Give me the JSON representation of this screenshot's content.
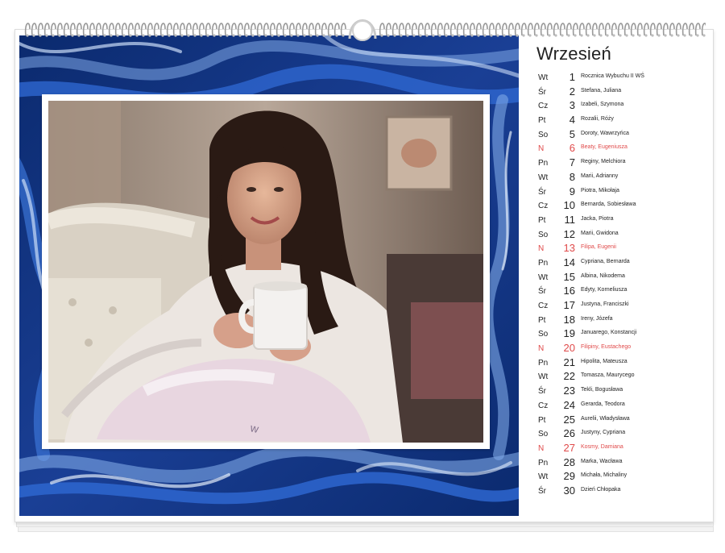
{
  "calendar": {
    "month": "Wrzesień",
    "days": [
      {
        "dow": "Wt",
        "num": "1",
        "names": "Rocznica Wybuchu II WŚ",
        "sunday": false
      },
      {
        "dow": "Śr",
        "num": "2",
        "names": "Stefana, Juliana",
        "sunday": false
      },
      {
        "dow": "Cz",
        "num": "3",
        "names": "Izabeli, Szymona",
        "sunday": false
      },
      {
        "dow": "Pt",
        "num": "4",
        "names": "Rozalii, Róży",
        "sunday": false
      },
      {
        "dow": "So",
        "num": "5",
        "names": "Doroty, Wawrzyńca",
        "sunday": false
      },
      {
        "dow": "N",
        "num": "6",
        "names": "Beaty, Eugeniusza",
        "sunday": true
      },
      {
        "dow": "Pn",
        "num": "7",
        "names": "Reginy, Melchiora",
        "sunday": false
      },
      {
        "dow": "Wt",
        "num": "8",
        "names": "Marii, Adrianny",
        "sunday": false
      },
      {
        "dow": "Śr",
        "num": "9",
        "names": "Piotra, Mikołaja",
        "sunday": false
      },
      {
        "dow": "Cz",
        "num": "10",
        "names": "Bernarda, Sobiesława",
        "sunday": false
      },
      {
        "dow": "Pt",
        "num": "11",
        "names": "Jacka, Piotra",
        "sunday": false
      },
      {
        "dow": "So",
        "num": "12",
        "names": "Marii, Gwidona",
        "sunday": false
      },
      {
        "dow": "N",
        "num": "13",
        "names": "Filipa, Eugenii",
        "sunday": true
      },
      {
        "dow": "Pn",
        "num": "14",
        "names": "Cypriana, Bernarda",
        "sunday": false
      },
      {
        "dow": "Wt",
        "num": "15",
        "names": "Albina, Nikodema",
        "sunday": false
      },
      {
        "dow": "Śr",
        "num": "16",
        "names": "Edyty, Korneliusza",
        "sunday": false
      },
      {
        "dow": "Cz",
        "num": "17",
        "names": "Justyna, Franciszki",
        "sunday": false
      },
      {
        "dow": "Pt",
        "num": "18",
        "names": "Ireny, Józefa",
        "sunday": false
      },
      {
        "dow": "So",
        "num": "19",
        "names": "Januarego, Konstancji",
        "sunday": false
      },
      {
        "dow": "N",
        "num": "20",
        "names": "Filipiny, Eustachego",
        "sunday": true
      },
      {
        "dow": "Pn",
        "num": "21",
        "names": "Hipolita, Mateusza",
        "sunday": false
      },
      {
        "dow": "Wt",
        "num": "22",
        "names": "Tomasza, Maurycego",
        "sunday": false
      },
      {
        "dow": "Śr",
        "num": "23",
        "names": "Tekli, Bogusława",
        "sunday": false
      },
      {
        "dow": "Cz",
        "num": "24",
        "names": "Gerarda, Teodora",
        "sunday": false
      },
      {
        "dow": "Pt",
        "num": "25",
        "names": "Aurelii, Władysława",
        "sunday": false
      },
      {
        "dow": "So",
        "num": "26",
        "names": "Justyny, Cypriana",
        "sunday": false
      },
      {
        "dow": "N",
        "num": "27",
        "names": "Kosmy, Damiana",
        "sunday": true
      },
      {
        "dow": "Pn",
        "num": "28",
        "names": "Marka, Wacława",
        "sunday": false
      },
      {
        "dow": "Wt",
        "num": "29",
        "names": "Michała, Michaliny",
        "sunday": false
      },
      {
        "dow": "Śr",
        "num": "30",
        "names": "Dzień Chłopaka",
        "sunday": false
      }
    ]
  },
  "colors": {
    "sunday": "#e04a4a",
    "marble_dark": "#0b2a6e",
    "marble_mid": "#1e4fb0",
    "marble_light": "#7fa8e6"
  },
  "photo": {
    "icon": "woman-with-mug-photo"
  }
}
